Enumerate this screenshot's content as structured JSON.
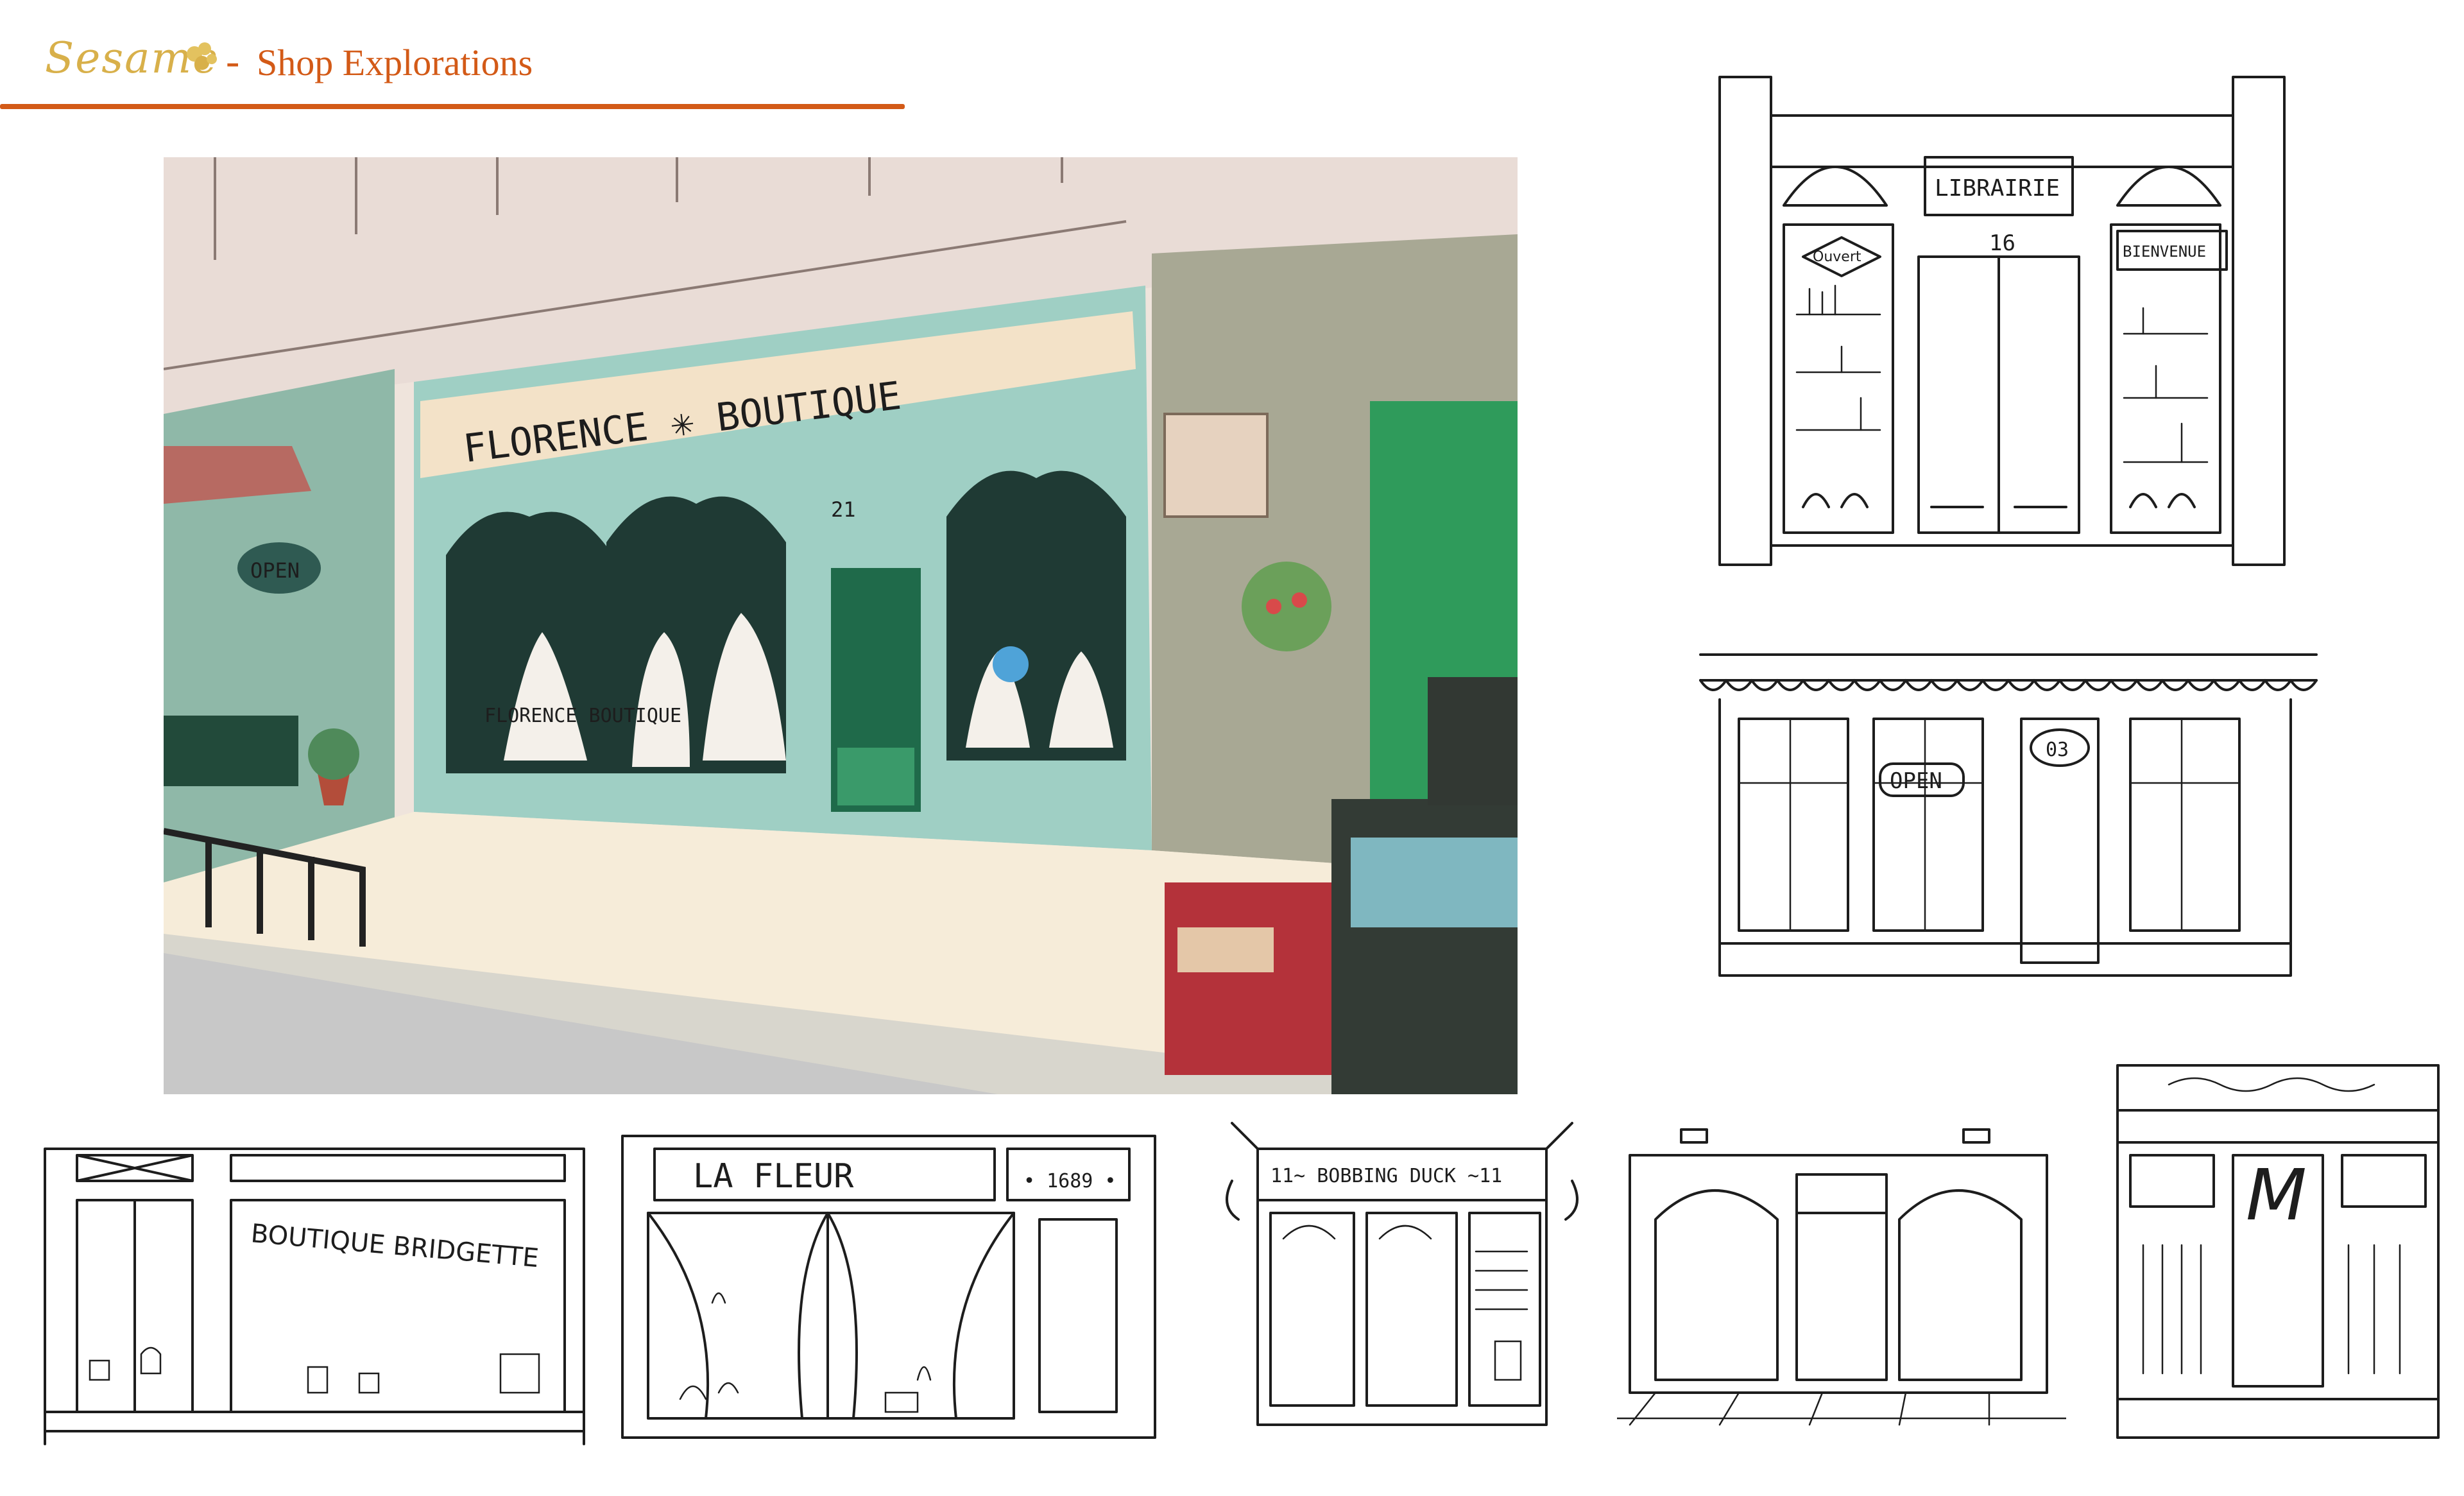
{
  "header": {
    "brand": "Sesame",
    "separator": "-",
    "title": "Shop Explorations",
    "accent_color": "#d35a17",
    "brand_color": "#d8b04a"
  },
  "main_illustration": {
    "sign": "FLORENCE ✳ BOUTIQUE",
    "window_text": "FLORENCE BOUTIQUE",
    "door_number": "21",
    "hanging_sign": "OPEN"
  },
  "sketches": {
    "librairie": {
      "sign": "LIBRAIRIE",
      "number": "16",
      "left_sign": "Ouvert",
      "right_sign": "BIENVENUE"
    },
    "open_shop": {
      "sign": "OPEN",
      "number": "03"
    },
    "bridgette": {
      "sign": "BOUTIQUE BRIDGETTE"
    },
    "la_fleur": {
      "sign": "LA FLEUR",
      "plaque": "• 1689 •"
    },
    "bobbing_duck": {
      "sign": "11~ BOBBING DUCK ~11"
    },
    "monogram": {
      "sign": "M"
    }
  }
}
